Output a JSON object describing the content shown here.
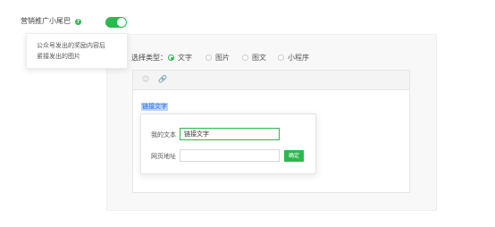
{
  "header": {
    "title": "营销推广小尾巴",
    "help_symbol": "?",
    "toggle_on": true
  },
  "tooltip": {
    "lines": [
      "公众号发出的奖励内容后",
      "紧接发出的图片"
    ]
  },
  "type_selector": {
    "label": "选择类型：",
    "options": [
      {
        "label": "文字",
        "selected": true
      },
      {
        "label": "图片",
        "selected": false
      },
      {
        "label": "图文",
        "selected": false
      },
      {
        "label": "小程序",
        "selected": false
      }
    ]
  },
  "editor": {
    "toolbar_icons": [
      "smiley-icon",
      "link-icon"
    ],
    "toolbar_glyphs": [
      "☺",
      "🔗"
    ],
    "content_text": "链接文字"
  },
  "link_dialog": {
    "text_label": "我的文本",
    "text_value": "链接文字",
    "url_label": "网页地址",
    "url_value": "",
    "confirm_label": "确定"
  },
  "colors": {
    "accent": "#2db84d",
    "selection": "#bcd4f5",
    "link": "#2a6fdb"
  }
}
